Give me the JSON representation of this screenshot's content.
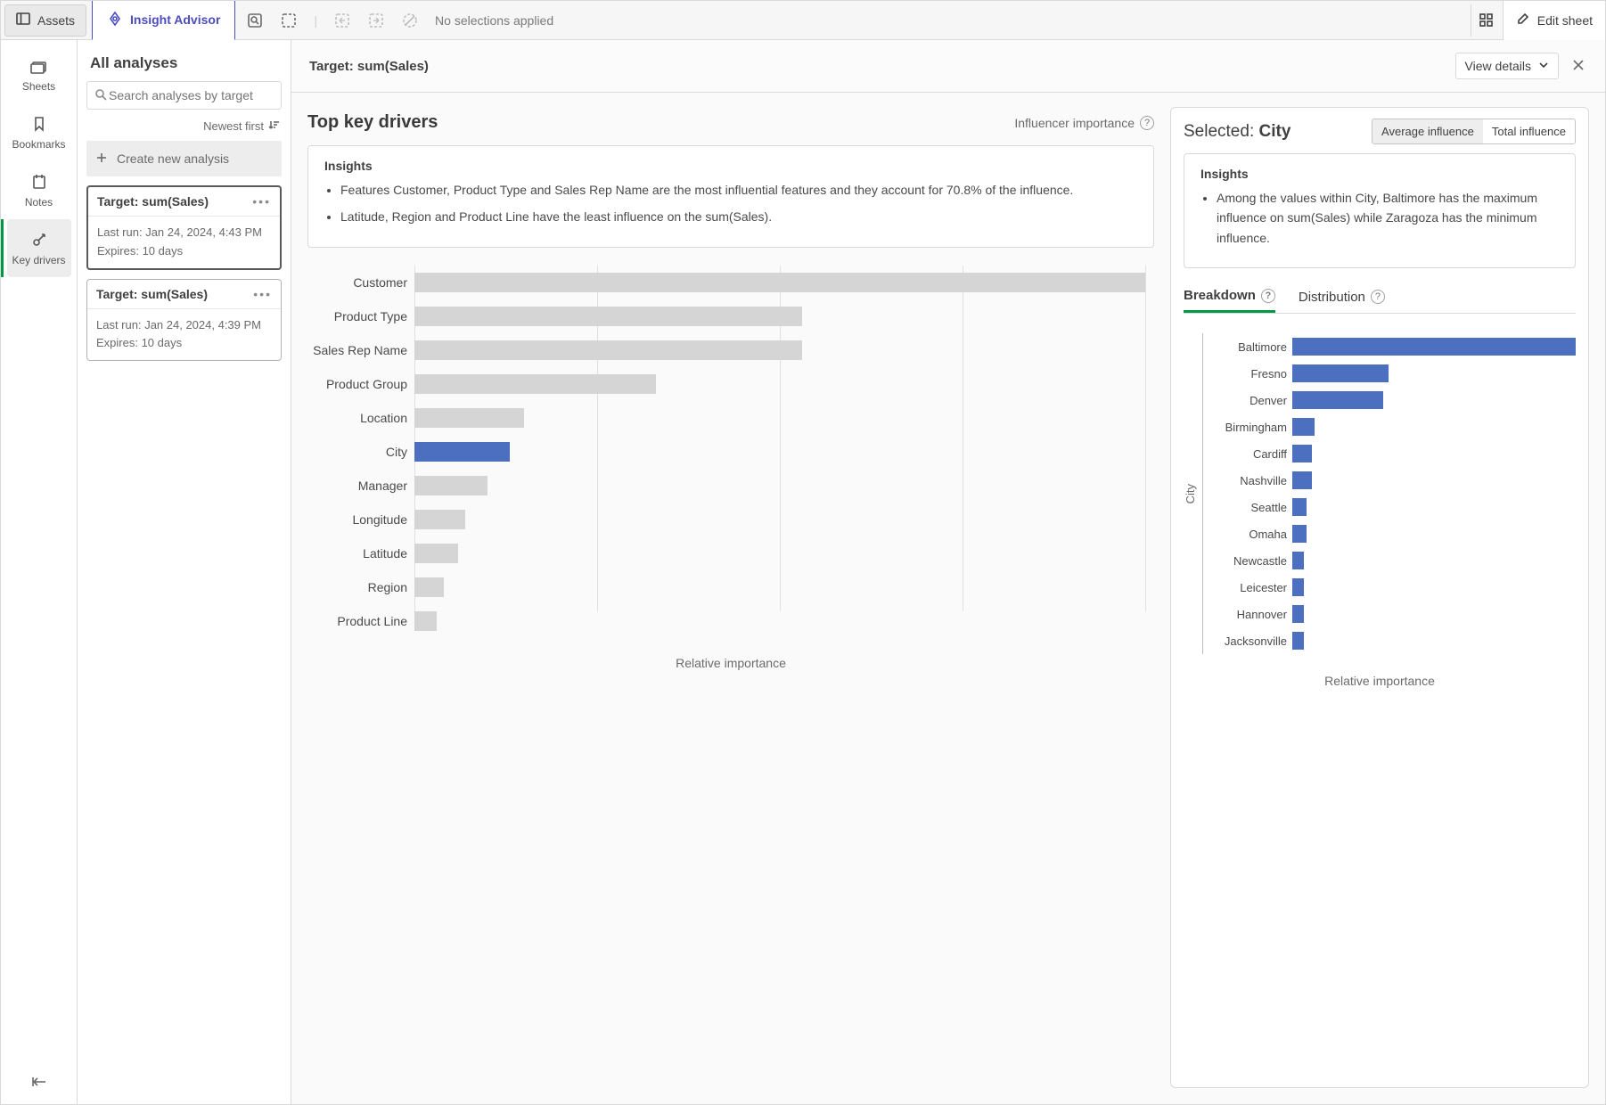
{
  "topbar": {
    "assets_label": "Assets",
    "insight_label": "Insight Advisor",
    "no_selections": "No selections applied",
    "edit_sheet": "Edit sheet"
  },
  "rail": {
    "sheets": "Sheets",
    "bookmarks": "Bookmarks",
    "notes": "Notes",
    "key_drivers": "Key drivers"
  },
  "analyses": {
    "title": "All analyses",
    "search_placeholder": "Search analyses by target",
    "sort_label": "Newest first",
    "create_label": "Create new analysis",
    "cards": [
      {
        "title": "Target: sum(Sales)",
        "last_run": "Last run: Jan 24, 2024, 4:43 PM",
        "expires": "Expires: 10 days"
      },
      {
        "title": "Target: sum(Sales)",
        "last_run": "Last run: Jan 24, 2024, 4:39 PM",
        "expires": "Expires: 10 days"
      }
    ]
  },
  "main": {
    "target_label": "Target: sum(Sales)",
    "view_details": "View details",
    "section_title": "Top key drivers",
    "influencer_label": "Influencer importance",
    "insights_header": "Insights",
    "insight1": "Features Customer, Product Type and Sales Rep Name are the most influential features and they account for 70.8% of the influence.",
    "insight2": "Latitude, Region and Product Line have the least influence on the sum(Sales).",
    "xlabel": "Relative importance"
  },
  "right": {
    "selected_prefix": "Selected: ",
    "selected_value": "City",
    "toggle_avg": "Average influence",
    "toggle_total": "Total influence",
    "insights_header": "Insights",
    "insight1": "Among the values within City, Baltimore has the maximum influence on sum(Sales) while Zaragoza has the minimum influence.",
    "tab_breakdown": "Breakdown",
    "tab_distribution": "Distribution",
    "xlabel": "Relative importance",
    "ylabel": "City"
  },
  "chart_data": [
    {
      "type": "bar",
      "name": "top_key_drivers",
      "title": "Top key drivers",
      "xlabel": "Relative importance",
      "ylabel": "",
      "categories": [
        "Customer",
        "Product Type",
        "Sales Rep Name",
        "Product Group",
        "Location",
        "City",
        "Manager",
        "Longitude",
        "Latitude",
        "Region",
        "Product Line"
      ],
      "values": [
        100,
        53,
        53,
        33,
        15,
        13,
        10,
        7,
        6,
        4,
        3
      ],
      "highlight": "City",
      "ylim": null
    },
    {
      "type": "bar",
      "name": "city_breakdown",
      "title": "Breakdown by City — Average influence",
      "xlabel": "Relative importance",
      "ylabel": "City",
      "categories": [
        "Baltimore",
        "Fresno",
        "Denver",
        "Birmingham",
        "Cardiff",
        "Nashville",
        "Seattle",
        "Omaha",
        "Newcastle",
        "Leicester",
        "Hannover",
        "Jacksonville"
      ],
      "values": [
        100,
        34,
        32,
        8,
        7,
        7,
        5,
        5,
        4,
        4,
        4,
        4
      ],
      "ylim": null
    }
  ]
}
